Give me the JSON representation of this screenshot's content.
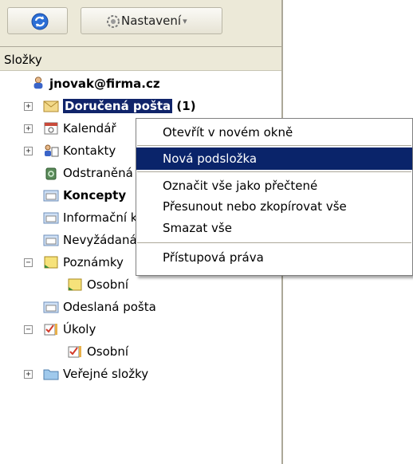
{
  "toolbar": {
    "settings_label": "Nastavení",
    "refresh_icon": "refresh-icon",
    "settings_icon": "gear-icon"
  },
  "folders_header": "Složky",
  "tree": {
    "account": "jnovak@firma.cz",
    "inbox": "Doručená pošta",
    "inbox_count": "(1)",
    "calendar": "Kalendář",
    "contacts": "Kontakty",
    "deleted": "Odstraněná pošta",
    "drafts": "Koncepty",
    "info": "Informační kanály",
    "junk": "Nevyžádaná pošta",
    "notes": "Poznámky",
    "notes_personal": "Osobní",
    "sent": "Odeslaná pošta",
    "tasks": "Úkoly",
    "tasks_personal": "Osobní",
    "public": "Veřejné složky"
  },
  "context_menu": {
    "items": [
      "Otevřít v novém okně",
      "Nová podsložka",
      "Označit vše jako přečtené",
      "Přesunout nebo zkopírovat vše",
      "Smazat vše",
      "Přístupová práva"
    ],
    "highlighted": "Nová podsložka"
  },
  "colors": {
    "selection": "#0a246a",
    "toolbar_bg": "#ece9d8"
  }
}
